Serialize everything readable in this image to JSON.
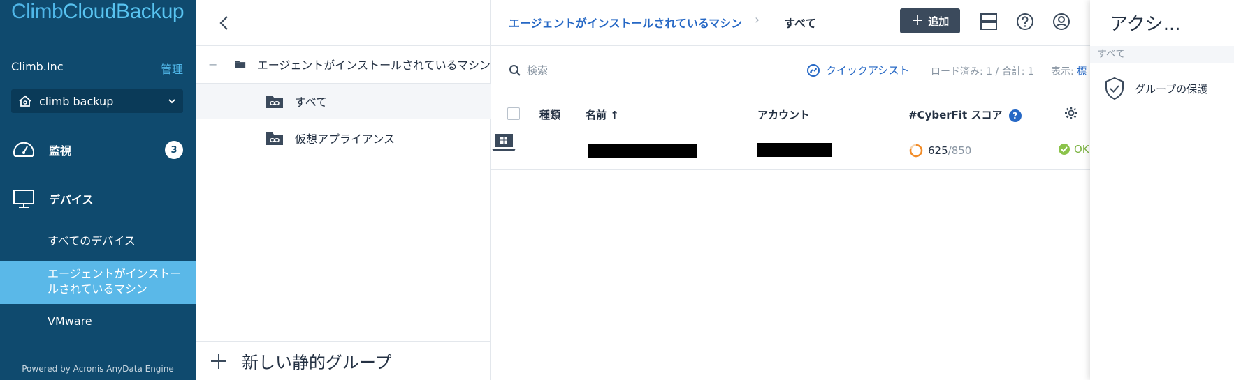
{
  "sidebar": {
    "logo_climb": "Climb",
    "logo_cloud": "CloudBackup",
    "org_name": "Climb.Inc",
    "admin_link": "管理",
    "tenant": "climb backup",
    "nav_monitoring": "監視",
    "monitoring_badge": "3",
    "nav_devices": "デバイス",
    "sub_all_devices": "すべてのデバイス",
    "sub_agent_machines_1": "エージェントがインストー",
    "sub_agent_machines_2": "ルされているマシン",
    "sub_vmware": "VMware",
    "powered_by": "Powered by Acronis AnyData Engine"
  },
  "groups": {
    "collapse": "−",
    "root": "エージェントがインストールされているマシン",
    "items": [
      "すべて",
      "仮想アプライアンス"
    ],
    "new_group": "新しい静的グループ"
  },
  "header": {
    "crumb_parent": "エージェントがインストールされているマシン",
    "crumb_sep": "›",
    "crumb_current": "すべて",
    "add_button": "追加"
  },
  "toolbar": {
    "search_placeholder": "検索",
    "quick_assist": "クイックアシスト",
    "loaded": "ロード済み: 1 / 合計: 1",
    "display_label": "表示:",
    "display_value": "標"
  },
  "table": {
    "columns": [
      "種類",
      "名前 ↑",
      "アカウント",
      "#CyberFit スコア",
      "?"
    ],
    "rows": [
      {
        "score": "625",
        "score_max": "/850",
        "status": "OK"
      }
    ]
  },
  "actions": {
    "title": "アクシ...",
    "section": "すべて",
    "item_protect_group": "グループの保護"
  },
  "colors": {
    "sidebar_bg": "#0f4a6e",
    "active_bg": "#5ab8e8",
    "link": "#2668c5",
    "ok": "#7cb342",
    "score_ring": "#f28c28"
  }
}
